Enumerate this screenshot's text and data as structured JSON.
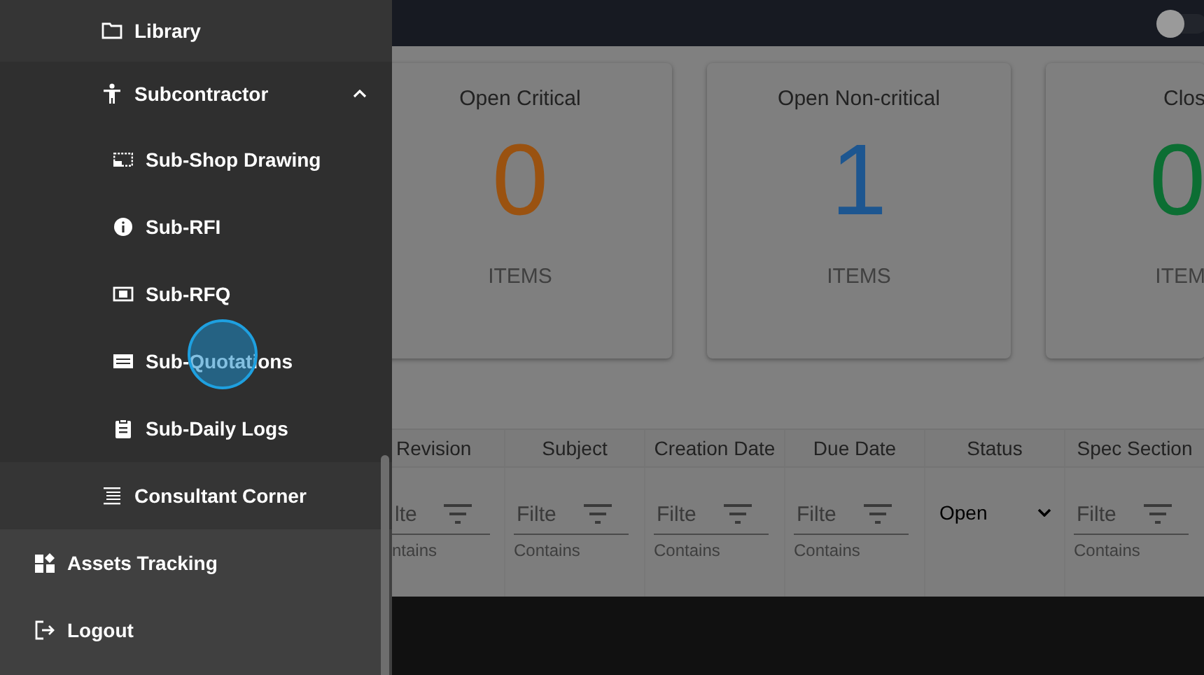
{
  "sidebar": {
    "nested_items": [
      {
        "label": "Library"
      },
      {
        "label": "Subcontractor",
        "expanded": true,
        "children": [
          {
            "label": "Sub-Shop Drawing"
          },
          {
            "label": "Sub-RFI"
          },
          {
            "label": "Sub-RFQ"
          },
          {
            "label": "Sub-Quotations"
          },
          {
            "label": "Sub-Daily Logs"
          }
        ]
      },
      {
        "label": "Consultant Corner"
      }
    ],
    "items": [
      {
        "label": "Assets Tracking"
      },
      {
        "label": "Logout"
      }
    ]
  },
  "toggle": {
    "on": false
  },
  "cards": [
    {
      "title": "Open Critical",
      "count": "0",
      "unit": "ITEMS",
      "color": "#9a5210"
    },
    {
      "title": "Open Non-critical",
      "count": "1",
      "unit": "ITEMS",
      "color": "#1d5690"
    },
    {
      "title": "Clos",
      "count": "0",
      "unit": "ITEM",
      "color": "#0c6e33"
    }
  ],
  "table": {
    "columns": [
      {
        "label": "Revision",
        "kind": "text",
        "placeholder": "lte",
        "operator": "ntains"
      },
      {
        "label": "Subject",
        "kind": "text",
        "placeholder": "Filte",
        "operator": "Contains"
      },
      {
        "label": "Creation Date",
        "kind": "text",
        "placeholder": "Filte",
        "operator": "Contains"
      },
      {
        "label": "Due Date",
        "kind": "text",
        "placeholder": "Filte",
        "operator": "Contains"
      },
      {
        "label": "Status",
        "kind": "select",
        "value": "Open"
      },
      {
        "label": "Spec Section",
        "kind": "text",
        "placeholder": "Filte",
        "operator": "Contains"
      }
    ]
  }
}
